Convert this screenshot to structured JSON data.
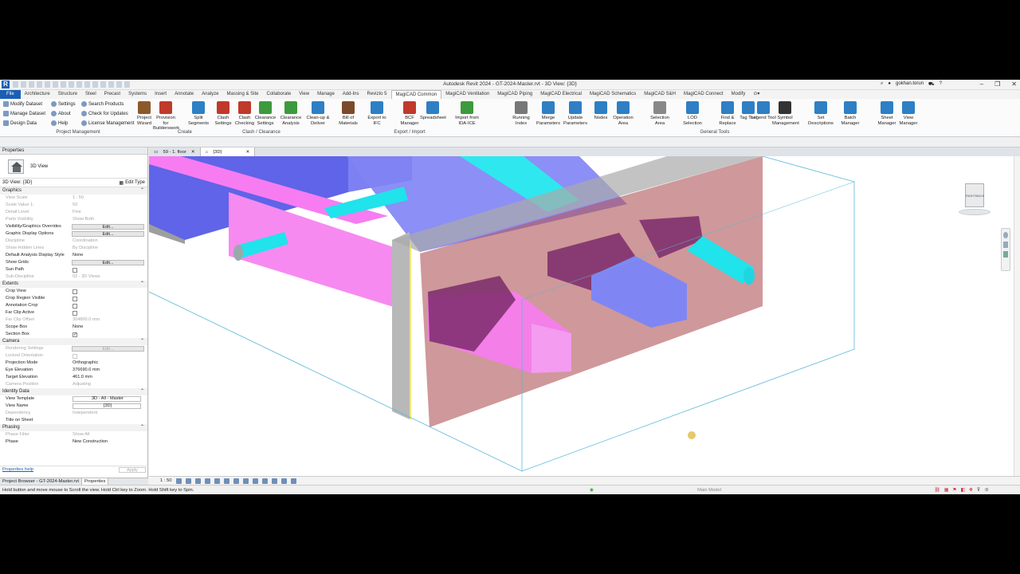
{
  "titlebar": {
    "title": "Autodesk Revit 2024 - GT-2024-Master.rvt - 3D View: {3D}",
    "user": "gokhan.torun"
  },
  "tabs": [
    "File",
    "Architecture",
    "Structure",
    "Steel",
    "Precast",
    "Systems",
    "Insert",
    "Annotate",
    "Analyze",
    "Massing & Site",
    "Collaborate",
    "View",
    "Manage",
    "Add-Ins",
    "Revizto 5",
    "MagiCAD Common",
    "MagiCAD Ventilation",
    "MagiCAD Piping",
    "MagiCAD Electrical",
    "MagiCAD Schematics",
    "MagiCAD S&H",
    "MagiCAD Connect",
    "Modify"
  ],
  "ribbon": {
    "small": [
      "Modify Dataset",
      "Manage Dataset",
      "Design Data",
      "Settings",
      "About",
      "Help",
      "Search Products",
      "Check for Updates",
      "License Management"
    ],
    "big": [
      {
        "label": "Project Wizard",
        "color": "#8a5a2b"
      },
      {
        "label": "Provision for Builderswork",
        "color": "#c0392b"
      },
      {
        "label": "Split Segments",
        "color": "#2e7fc4"
      },
      {
        "label": "Clash Settings",
        "color": "#c0392b"
      },
      {
        "label": "Clash Checking",
        "color": "#c0392b"
      },
      {
        "label": "Clearance Settings",
        "color": "#3d9a3d"
      },
      {
        "label": "Clearance Analysis",
        "color": "#3d9a3d"
      },
      {
        "label": "Clean-up & Deliver",
        "color": "#2e7fc4"
      },
      {
        "label": "Bill of Materials",
        "color": "#7b4a2a"
      },
      {
        "label": "Export to IFC",
        "color": "#2e7fc4"
      },
      {
        "label": "BCF Manager",
        "color": "#c0392b"
      },
      {
        "label": "Spreadsheet",
        "color": "#2e7fc4"
      },
      {
        "label": "Import from IDA-ICE",
        "color": "#3d9a3d"
      },
      {
        "label": "Running Index",
        "color": "#777777"
      },
      {
        "label": "Merge Parameters",
        "color": "#2e7fc4"
      },
      {
        "label": "Update Parameters",
        "color": "#2e7fc4"
      },
      {
        "label": "Nodes",
        "color": "#2e7fc4"
      },
      {
        "label": "Operation Area",
        "color": "#2e7fc4"
      },
      {
        "label": "Selection Area",
        "color": "#888888"
      },
      {
        "label": "LOD Selection",
        "color": "#2e7fc4"
      },
      {
        "label": "Find & Replace",
        "color": "#2e7fc4"
      },
      {
        "label": "Tag Tool",
        "color": "#2e7fc4"
      },
      {
        "label": "Legend Tool",
        "color": "#2e7fc4"
      },
      {
        "label": "Symbol Management",
        "color": "#333333"
      },
      {
        "label": "Set Descriptions",
        "color": "#2e7fc4"
      },
      {
        "label": "Batch Manager",
        "color": "#2e7fc4"
      },
      {
        "label": "Sheet Manager",
        "color": "#2e7fc4"
      },
      {
        "label": "View Manager",
        "color": "#2e7fc4"
      }
    ],
    "groups": [
      "Project Management",
      "Create",
      "Clash / Clearance",
      "Export / Import",
      "General Tools"
    ]
  },
  "properties": {
    "title": "Properties",
    "type_name": "3D View",
    "selector": "3D View: {3D}",
    "edit_type": "Edit Type",
    "graphics": "Graphics",
    "g_rows": [
      {
        "k": "View Scale",
        "v": "1 : 50",
        "d": true
      },
      {
        "k": "Scale Value    1:",
        "v": "50",
        "d": true
      },
      {
        "k": "Detail Level",
        "v": "Fine",
        "d": true
      },
      {
        "k": "Parts Visibility",
        "v": "Show Both",
        "d": true
      }
    ],
    "vg": "Visibility/Graphics Overrides",
    "gdo": "Graphic Display Options",
    "edit": "Edit...",
    "g_rows2": [
      {
        "k": "Discipline",
        "v": "Coordination",
        "d": true
      },
      {
        "k": "Show Hidden Lines",
        "v": "By Discipline",
        "d": true
      },
      {
        "k": "Default Analysis Display Style",
        "v": "None",
        "d": false
      }
    ],
    "show_grids": "Show Grids",
    "sun_path": "Sun Path",
    "sub_discipline": {
      "k": "Sub-Discipline",
      "v": "02 - 3D Views"
    },
    "extents": "Extents",
    "ext_rows": [
      "Crop View",
      "Crop Region Visible",
      "Annotation Crop",
      "Far Clip Active"
    ],
    "far_clip_offset": {
      "k": "Far Clip Offset",
      "v": "304800.0 mm"
    },
    "scope_box": {
      "k": "Scope Box",
      "v": "None"
    },
    "section_box": "Section Box",
    "camera": "Camera",
    "rendering": "Rendering Settings",
    "locked": "Locked Orientation",
    "cam_rows": [
      {
        "k": "Projection Mode",
        "v": "Orthographic",
        "d": false
      },
      {
        "k": "Eye Elevation",
        "v": "376690.0 mm",
        "d": false
      },
      {
        "k": "Target Elevation",
        "v": "461.0 mm",
        "d": false
      },
      {
        "k": "Camera Position",
        "v": "Adjusting",
        "d": true
      }
    ],
    "identity": "Identity Data",
    "view_template": {
      "k": "View Template",
      "v": "3D - All  -  Master"
    },
    "view_name": {
      "k": "View Name",
      "v": "{3D}"
    },
    "dependency": {
      "k": "Dependency",
      "v": "Independent"
    },
    "title_on_sheet": "Title on Sheet",
    "phasing": "Phasing",
    "phase_filter": {
      "k": "Phase Filter",
      "v": "Show All"
    },
    "phase": {
      "k": "Phase",
      "v": "New Construction"
    },
    "help": "Properties help",
    "apply": "Apply"
  },
  "bottom_tabs": [
    "Project Browser - GT-2024-Master.rvt",
    "Properties"
  ],
  "doc_tabs": [
    "59 - 1. floor",
    "{3D}"
  ],
  "viewbar": {
    "scale": "1 : 50"
  },
  "status": {
    "hint": "Hold button and move mouse to Scroll the view. Hold Ctrl key to Zoom. Hold Shift key to Spin.",
    "model": "Main Model",
    "count": ":0"
  },
  "viewcube": {
    "right": "RIGHT",
    "back": "BACK"
  }
}
